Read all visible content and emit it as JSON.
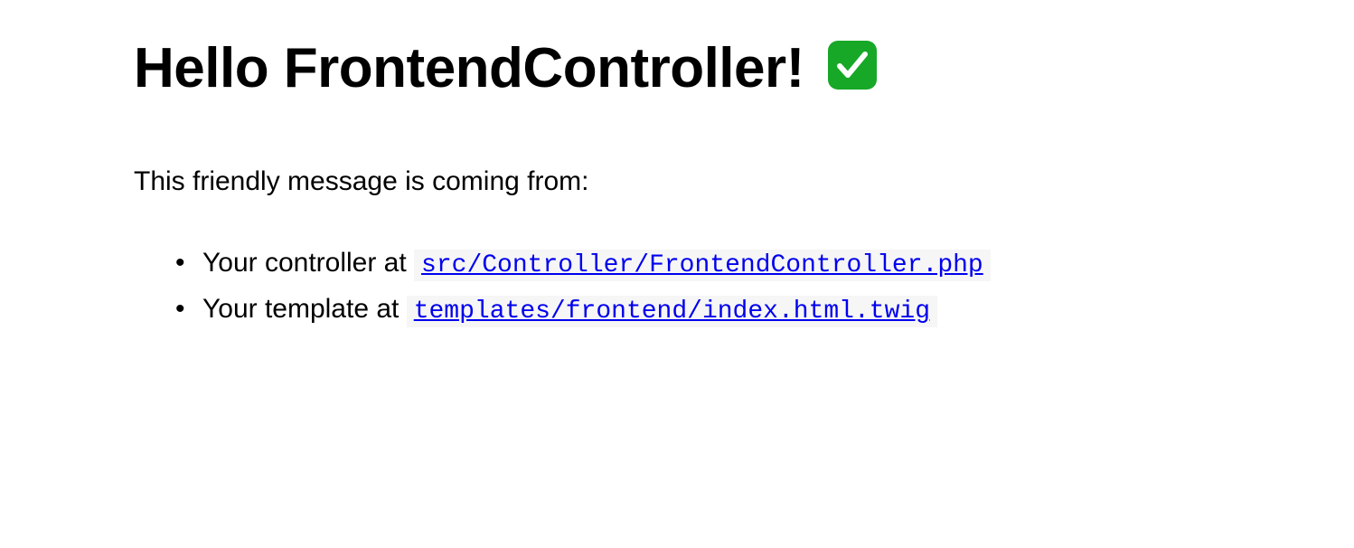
{
  "heading": {
    "text": "Hello FrontendController!",
    "icon_name": "check-mark-icon"
  },
  "intro": "This friendly message is coming from:",
  "items": [
    {
      "label": "Your controller at ",
      "link_text": "src/Controller/FrontendController.php"
    },
    {
      "label": "Your template at ",
      "link_text": "templates/frontend/index.html.twig"
    }
  ]
}
